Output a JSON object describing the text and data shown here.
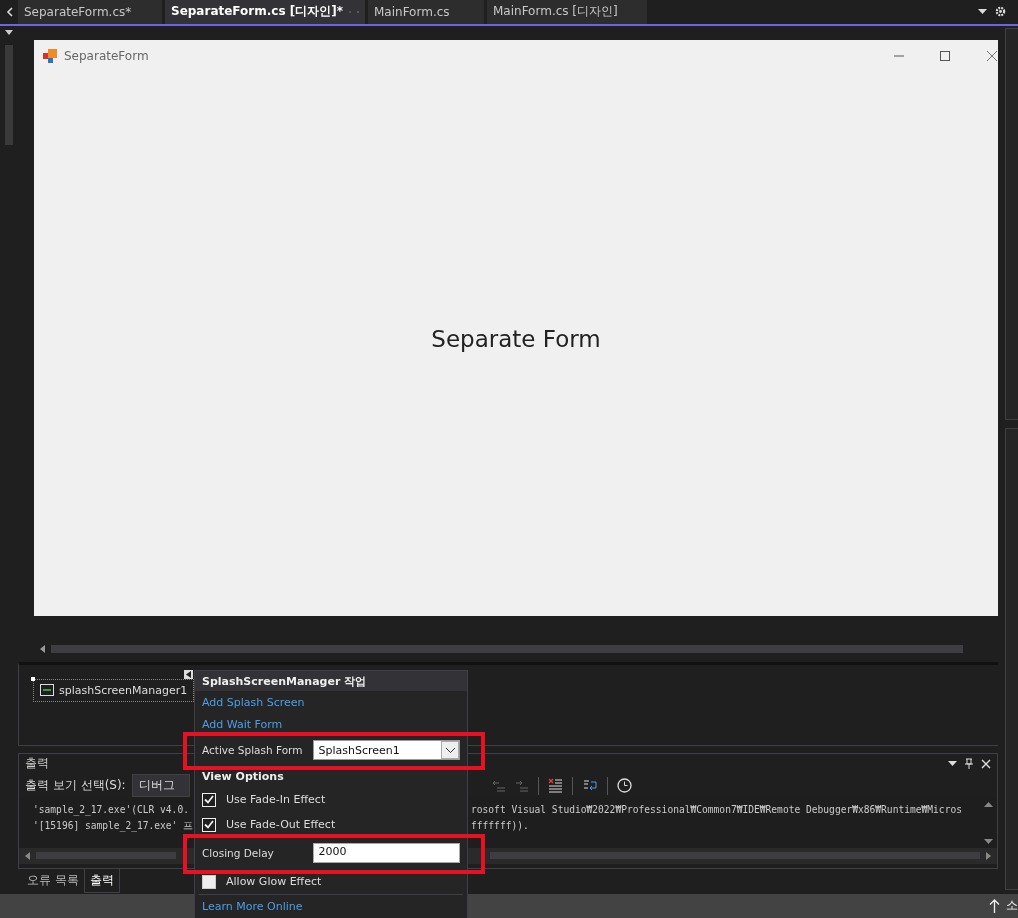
{
  "tabs": [
    {
      "label": "SeparateForm.cs*",
      "selected": false
    },
    {
      "label": "SeparateForm.cs [디자인]*",
      "selected": true
    },
    {
      "label": "MainForm.cs",
      "selected": false
    },
    {
      "label": "MainForm.cs [디자인]",
      "selected": false
    }
  ],
  "form": {
    "title": "SeparateForm",
    "label": "Separate Form"
  },
  "component_tray": {
    "items": [
      {
        "label": "splashScreenManager1",
        "selected": true
      }
    ]
  },
  "smart_tag": {
    "title": "SplashScreenManager 작업",
    "items": [
      {
        "kind": "link",
        "label": "Add Splash Screen"
      },
      {
        "kind": "link",
        "label": "Add Wait Form"
      },
      {
        "kind": "combo",
        "label": "Active Splash Form",
        "value": "SplashScreen1",
        "highlighted": true
      },
      {
        "kind": "header",
        "label": "View Options"
      },
      {
        "kind": "checkbox",
        "label": "Use Fade-In Effect",
        "checked": true
      },
      {
        "kind": "checkbox",
        "label": "Use Fade-Out Effect",
        "checked": true
      },
      {
        "kind": "text",
        "label": "Closing Delay",
        "value": "2000",
        "highlighted": true
      },
      {
        "kind": "checkbox",
        "label": "Allow Glow Effect",
        "checked": false
      },
      {
        "kind": "link",
        "label": "Learn More Online"
      }
    ]
  },
  "output": {
    "title": "출력",
    "source_label": "출력 보기 선택(S):",
    "source_value": "디버그",
    "lines": [
      {
        "left": "'sample_2_17.exe'(CLR v4.0.",
        "right": "rosoft Visual Studio₩2022₩Professional₩Common7₩IDE₩Remote Debugger₩x86₩Runtime₩Micros"
      },
      {
        "left": "'[15196] sample_2_17.exe' 프",
        "right": "fffffff))."
      }
    ]
  },
  "bottom_tabs": [
    {
      "label": "오류 목록",
      "selected": false
    },
    {
      "label": "출력",
      "selected": true
    }
  ],
  "status_bar": {
    "text": "소"
  }
}
